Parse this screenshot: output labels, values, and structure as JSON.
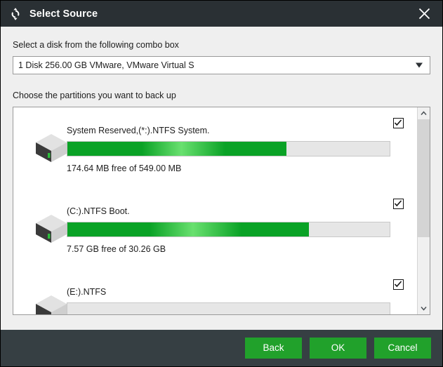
{
  "window": {
    "title": "Select Source",
    "icon": "sync-arrows-icon",
    "close_label": "×",
    "titlebar_color": "#2a3034",
    "footer_color": "#363f43",
    "body_color": "#efefef",
    "accent_color": "#21a12b"
  },
  "disk_section": {
    "label": "Select a disk from the following combo box",
    "selected_disk": "1 Disk 256.00 GB VMware,  VMware Virtual S",
    "options": [
      "1 Disk 256.00 GB VMware,  VMware Virtual S"
    ]
  },
  "partition_section": {
    "label": "Choose the partitions you want to back up",
    "partitions": [
      {
        "name": "System Reserved,(*:).NTFS System.",
        "free_text": "174.64 MB free of 549.00 MB",
        "used_percent": 68,
        "checked": true,
        "free_size": "174.64 MB",
        "total_size": "549.00 MB"
      },
      {
        "name": "(C:).NTFS Boot.",
        "free_text": "7.57 GB free of 30.26 GB",
        "used_percent": 75,
        "checked": true,
        "free_size": "7.57 GB",
        "total_size": "30.26 GB"
      },
      {
        "name": "(E:).NTFS",
        "free_text": "",
        "used_percent": 0,
        "checked": true,
        "free_size": "",
        "total_size": ""
      }
    ],
    "scrollbar": {
      "up_arrow": "chevron-up-icon",
      "down_arrow": "chevron-down-icon",
      "thumb_position": "top"
    }
  },
  "footer": {
    "back_label": "Back",
    "ok_label": "OK",
    "cancel_label": "Cancel"
  }
}
